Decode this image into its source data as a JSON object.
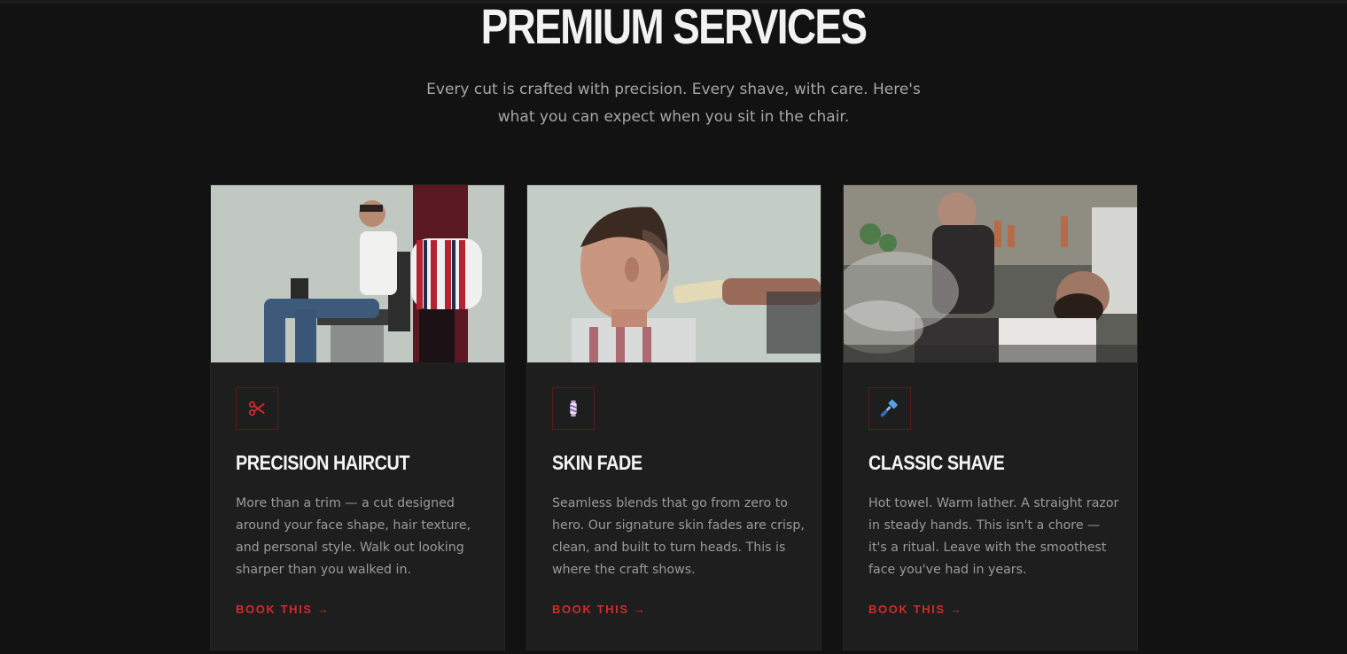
{
  "section": {
    "title": "PREMIUM SERVICES",
    "subtitle": "Every cut is crafted with precision. Every shave, with care. Here's what you can expect when you sit in the chair."
  },
  "colors": {
    "background": "#121212",
    "card": "#1e1e1e",
    "accent": "#d42a2a"
  },
  "services": [
    {
      "icon": "scissors-icon",
      "title": "PRECISION HAIRCUT",
      "description": "More than a trim — a cut designed around your face shape, hair texture, and personal style. Walk out looking sharper than you walked in.",
      "link": "BOOK THIS →"
    },
    {
      "icon": "barber-pole-icon",
      "title": "SKIN FADE",
      "description": "Seamless blends that go from zero to hero. Our signature skin fades are crisp, clean, and built to turn heads. This is where the craft shows.",
      "link": "BOOK THIS →"
    },
    {
      "icon": "razor-icon",
      "title": "CLASSIC SHAVE",
      "description": "Hot towel. Warm lather. A straight razor in steady hands. This isn't a chore — it's a ritual. Leave with the smoothest face you've had in years.",
      "link": "BOOK THIS →"
    }
  ]
}
